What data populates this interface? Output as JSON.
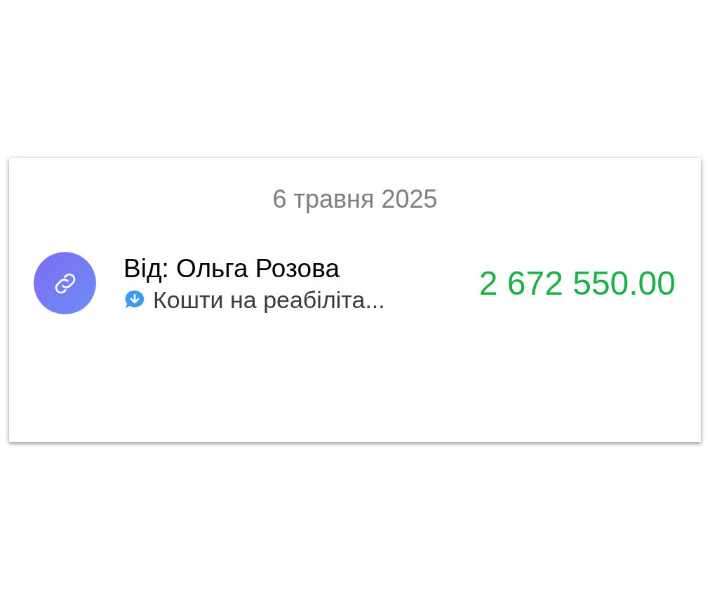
{
  "date_header": "6 травня 2025",
  "transactions": [
    {
      "title": "Від: Ольга Розова",
      "comment": "Кошти на реабіліта...",
      "amount": "2 672 550.00",
      "incoming": true
    }
  ]
}
